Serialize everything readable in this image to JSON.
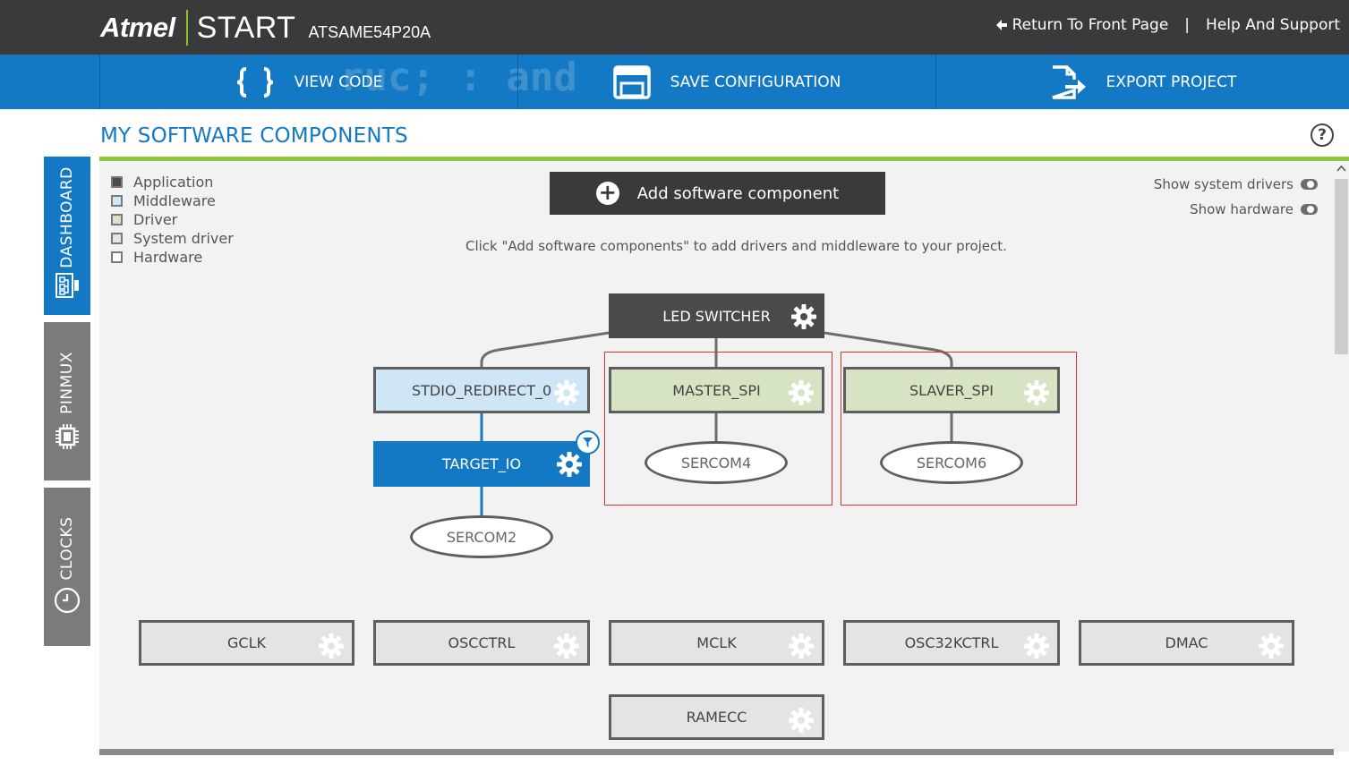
{
  "header": {
    "brand": "Atmel",
    "product": "START",
    "device": "ATSAME54P20A",
    "links": {
      "return": "Return To Front Page",
      "divider": "|",
      "help": "Help And Support"
    }
  },
  "actions": {
    "view_code": "VIEW CODE",
    "save": "SAVE CONFIGURATION",
    "export": "EXPORT PROJECT",
    "background_text": "ruc; : and"
  },
  "page": {
    "title": "MY SOFTWARE COMPONENTS",
    "help": "?"
  },
  "sidebar": {
    "tabs": [
      {
        "label": "DASHBOARD",
        "icon": "dashboard-icon",
        "active": true
      },
      {
        "label": "PINMUX",
        "icon": "chip-icon",
        "active": false
      },
      {
        "label": "CLOCKS",
        "icon": "clock-icon",
        "active": false
      }
    ]
  },
  "legend": [
    {
      "label": "Application",
      "color": "#4a4a4a"
    },
    {
      "label": "Middleware",
      "color": "#cfe6f6"
    },
    {
      "label": "Driver",
      "color": "#d6e4c4"
    },
    {
      "label": "System driver",
      "color": "#e4e4e4"
    },
    {
      "label": "Hardware",
      "color": "#ffffff"
    }
  ],
  "add_component": {
    "label": "Add software component",
    "hint": "Click \"Add software components\" to add drivers and middleware to your project."
  },
  "toggles": {
    "system_drivers": "Show system drivers",
    "hardware": "Show hardware"
  },
  "components": {
    "application": "LED SWITCHER",
    "middleware": "STDIO_REDIRECT_0",
    "selected_driver": "TARGET_IO",
    "drivers": [
      "MASTER_SPI",
      "SLAVER_SPI"
    ],
    "hardware": [
      "SERCOM2",
      "SERCOM4",
      "SERCOM6"
    ],
    "system_drivers": [
      "GCLK",
      "OSCCTRL",
      "MCLK",
      "OSC32KCTRL",
      "DMAC",
      "RAMECC"
    ]
  },
  "colors": {
    "accent": "#1479c4",
    "topbar": "#3a3a3a",
    "divider_green": "#8cc63f",
    "group_border": "#e03030"
  }
}
